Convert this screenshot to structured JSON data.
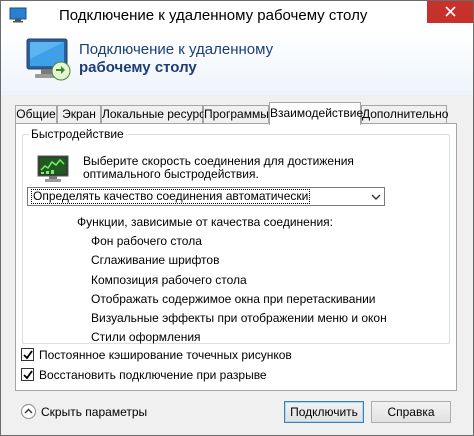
{
  "window": {
    "title": "Подключение к удаленному рабочему столу",
    "close_symbol": "close-icon"
  },
  "banner": {
    "line1": "Подключение к удаленному",
    "line2": "рабочему столу",
    "icon": "remote-desktop-icon"
  },
  "tabs": [
    {
      "label": "Общие",
      "active": false
    },
    {
      "label": "Экран",
      "active": false
    },
    {
      "label": "Локальные ресурсы",
      "active": false
    },
    {
      "label": "Программы",
      "active": false
    },
    {
      "label": "Взаимодействие",
      "active": true
    },
    {
      "label": "Дополнительно",
      "active": false
    }
  ],
  "performance": {
    "legend": "Быстродействие",
    "description": "Выберите скорость соединения для достижения оптимального быстродействия.",
    "select_value": "Определять качество соединения автоматически",
    "features_title": "Функции, зависимые от качества соединения:",
    "features": [
      "Фон рабочего стола",
      "Сглаживание шрифтов",
      "Композиция рабочего стола",
      "Отображать содержимое окна при перетаскивании",
      "Визуальные эффекты при отображении меню и окон",
      "Стили оформления"
    ]
  },
  "options": [
    {
      "label": "Постоянное кэширование точечных рисунков",
      "checked": true
    },
    {
      "label": "Восстановить подключение при разрыве",
      "checked": true
    }
  ],
  "footer": {
    "toggle_label": "Скрыть параметры",
    "connect_label": "Подключить",
    "help_label": "Справка"
  }
}
